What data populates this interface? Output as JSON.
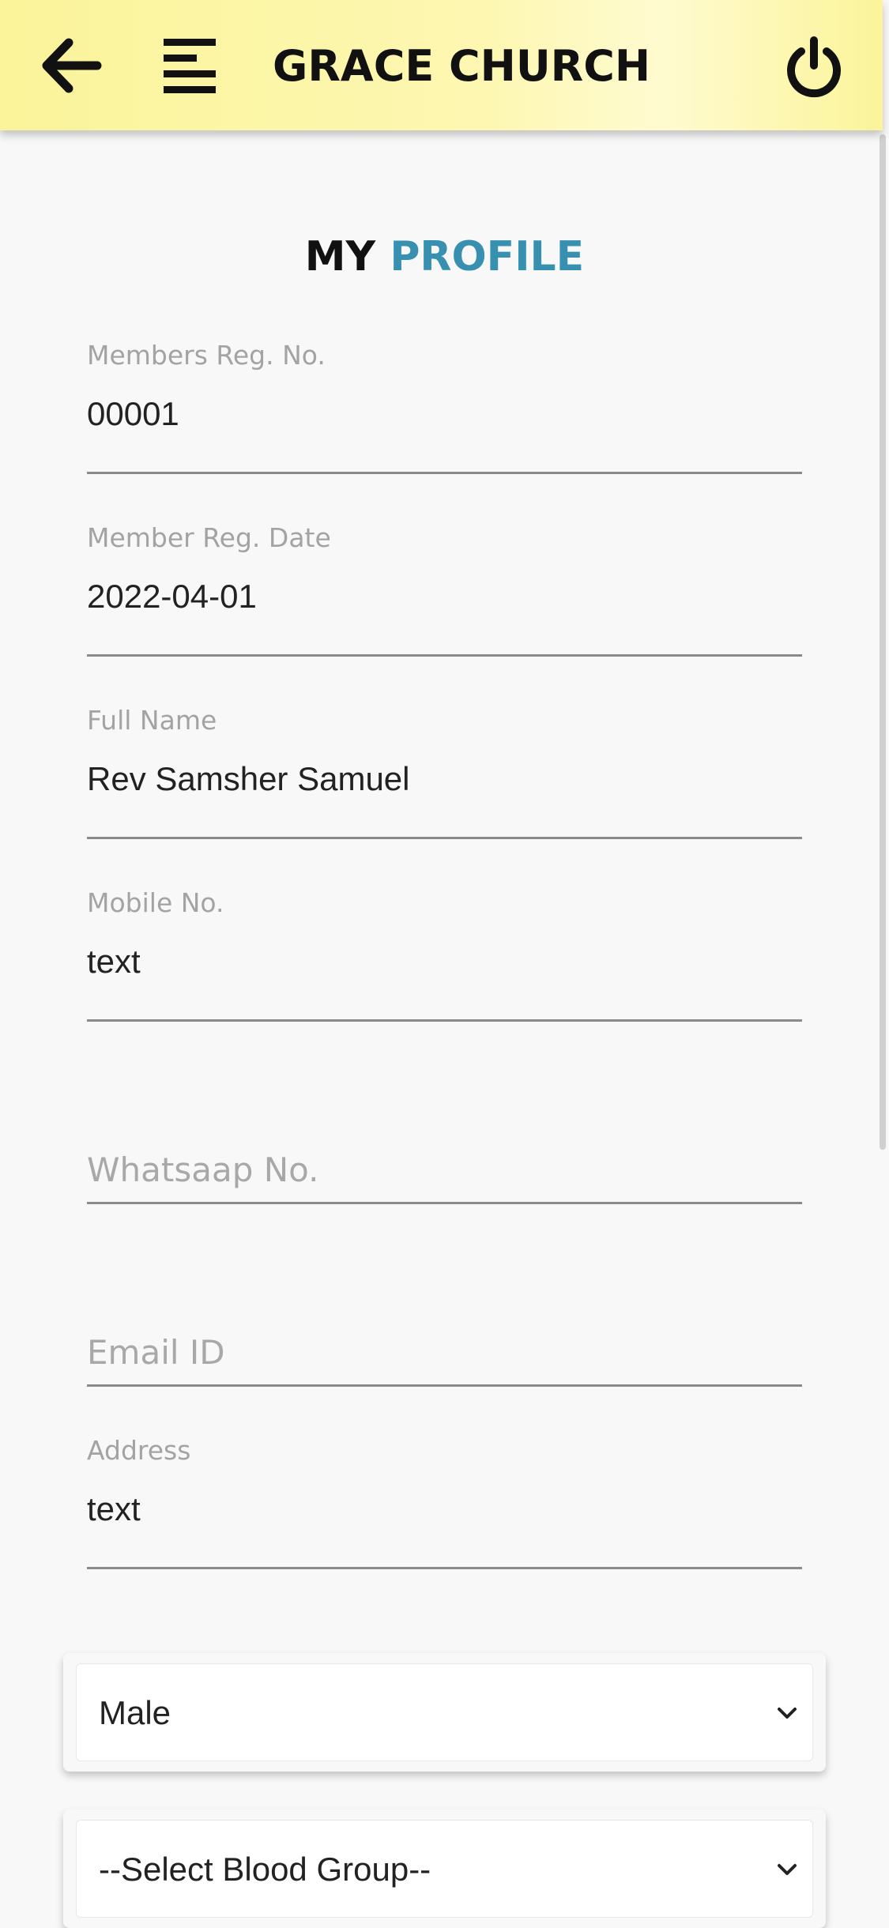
{
  "app_bar": {
    "title": "GRACE CHURCH",
    "icons": [
      "arrow-left-icon",
      "menu-icon",
      "power-icon"
    ]
  },
  "page": {
    "heading_first": "MY",
    "heading_second": "PROFILE",
    "accent_color": "#3790b0"
  },
  "fields": {
    "reg_no": {
      "label": "Members Reg. No.",
      "value": "00001"
    },
    "reg_date": {
      "label": "Member Reg. Date",
      "value": "2022-04-01"
    },
    "full_name": {
      "label": "Full Name",
      "value": "Rev Samsher Samuel"
    },
    "mobile": {
      "label": "Mobile No.",
      "value": "text"
    },
    "whatsapp": {
      "placeholder": "Whatsaap No."
    },
    "email": {
      "placeholder": "Email ID"
    },
    "address": {
      "label": "Address",
      "value": "text"
    }
  },
  "selects": {
    "gender": {
      "selected": "Male"
    },
    "blood_group": {
      "selected": "--Select Blood Group--"
    }
  }
}
